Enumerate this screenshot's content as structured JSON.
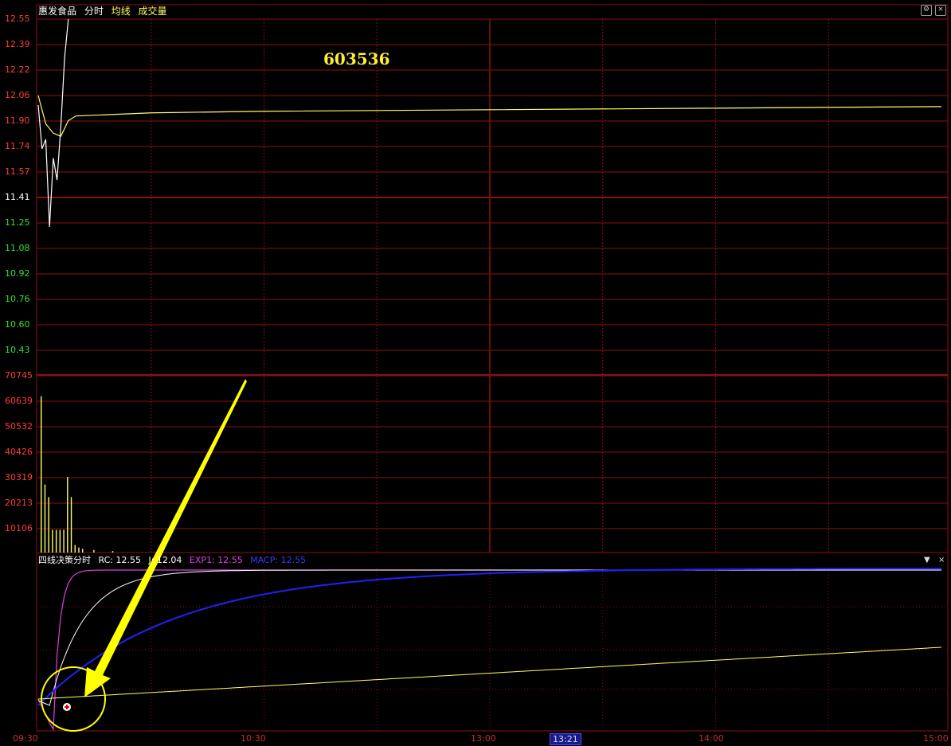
{
  "header": {
    "stock_name": "惠发食品",
    "mode": "分时",
    "avg_line": "均线",
    "volume": "成交量"
  },
  "stock_code": "603536",
  "indicator": {
    "name": "四线决策分时",
    "rc": "RC: 12.55",
    "j": "J: 12.04",
    "exp1": "EXP1: 12.55",
    "macp": "MACP: 12.55"
  },
  "price_axis": [
    "12.55",
    "12.39",
    "12.22",
    "12.06",
    "11.90",
    "11.74",
    "11.57",
    "11.41",
    "11.25",
    "11.08",
    "10.92",
    "10.76",
    "10.60",
    "10.43"
  ],
  "volume_axis": [
    "70745",
    "60639",
    "50532",
    "40426",
    "30319",
    "20213",
    "10106"
  ],
  "time_axis": [
    "09:30",
    "10:30",
    "13:00",
    "13:21",
    "14:00",
    "15:00"
  ],
  "colors": {
    "up": "#ff3b3b",
    "down": "#33e033",
    "neutral": "#ffffff",
    "grid": "#8b1010",
    "price_line": "#ffffff",
    "avg_line": "#ffff66",
    "volume": "#ffff66",
    "rc": "#ffffff",
    "j": "#ffffff",
    "exp1": "#e040e0",
    "macp": "#2020ff",
    "annotation": "#ffff00"
  },
  "icons": {
    "settings": "gear-icon",
    "close": "close-icon",
    "menu": "chevron-down-icon"
  },
  "chart_data": {
    "type": "line",
    "xlabel": "",
    "ylabel": "",
    "x_ticks": [
      "09:30",
      "10:30",
      "13:00",
      "14:00",
      "15:00"
    ],
    "price_range": [
      10.43,
      12.55
    ],
    "volume_range": [
      0,
      70745
    ],
    "series": [
      {
        "name": "",
        "times": [
          "09:30",
          "09:31",
          "09:32",
          "09:33",
          "09:34",
          "09:35",
          "09:36",
          "09:37",
          "09:38"
        ],
        "values": [
          12.0,
          11.72,
          11.78,
          11.22,
          11.66,
          11.52,
          11.86,
          12.3,
          12.55
        ]
      },
      {
        "name": "均线",
        "times": [
          "09:30",
          "09:32",
          "09:34",
          "09:36",
          "09:38",
          "09:40",
          "10:00",
          "10:30",
          "13:00",
          "14:00",
          "15:00"
        ],
        "values": [
          12.06,
          11.88,
          11.82,
          11.8,
          11.9,
          11.93,
          11.95,
          11.96,
          11.97,
          11.98,
          11.99
        ]
      },
      {
        "name": "成交量",
        "times": [
          "09:31",
          "09:32",
          "09:33",
          "09:34",
          "09:35",
          "09:36",
          "09:37",
          "09:38",
          "09:39",
          "09:40",
          "09:41",
          "09:42",
          "09:45",
          "09:50"
        ],
        "values": [
          62000,
          27000,
          22000,
          9000,
          9000,
          9000,
          9000,
          30000,
          22000,
          3000,
          2000,
          1500,
          1000,
          600
        ]
      }
    ],
    "indicator_series": [
      "RC",
      "J",
      "EXP1",
      "MACP"
    ]
  }
}
